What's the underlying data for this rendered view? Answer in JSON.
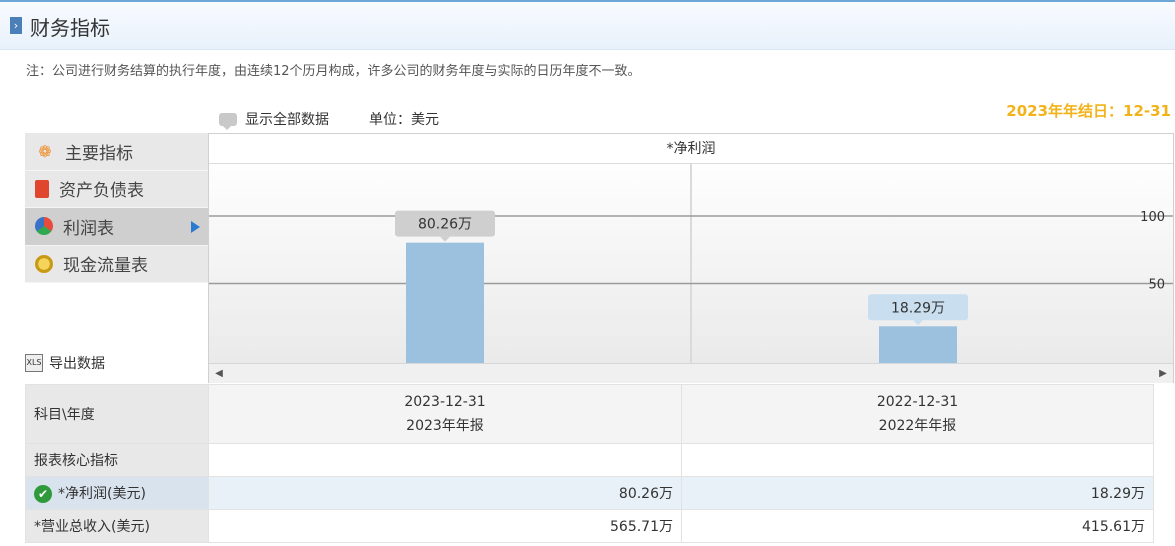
{
  "header": {
    "title": "财务指标"
  },
  "note": "注：公司进行财务结算的执行年度，由连续12个历月构成，许多公司的财务年度与实际的日历年度不一致。",
  "controls": {
    "show_all": "显示全部数据",
    "unit": "单位：美元",
    "year_end": "2023年年结日：12-31"
  },
  "nav": [
    {
      "label": "主要指标",
      "icon": "flower-icon"
    },
    {
      "label": "资产负债表",
      "icon": "document-icon"
    },
    {
      "label": "利润表",
      "icon": "pie-chart-icon",
      "active": true
    },
    {
      "label": "现金流量表",
      "icon": "coins-icon"
    }
  ],
  "export_label": "导出数据",
  "chart_data": {
    "type": "bar",
    "title": "*净利润",
    "categories": [
      "2023-12-31",
      "2022-12-31"
    ],
    "values": [
      80.26,
      18.29
    ],
    "value_labels": [
      "80.26万",
      "18.29万"
    ],
    "y_ticks": [
      50,
      100
    ],
    "grid": true,
    "colors": {
      "bar": "#9bc1df",
      "label_bg_first": "#cfcfcf",
      "label_bg_second": "#c9dff0"
    }
  },
  "table": {
    "col_header": "科目\\年度",
    "columns": [
      {
        "date": "2023-12-31",
        "report": "2023年年报"
      },
      {
        "date": "2022-12-31",
        "report": "2022年年报"
      }
    ],
    "section": "报表核心指标",
    "rows": [
      {
        "label": "*净利润(美元)",
        "values": [
          "80.26万",
          "18.29万"
        ],
        "highlight": true
      },
      {
        "label": "*营业总收入(美元)",
        "values": [
          "565.71万",
          "415.61万"
        ]
      }
    ]
  }
}
